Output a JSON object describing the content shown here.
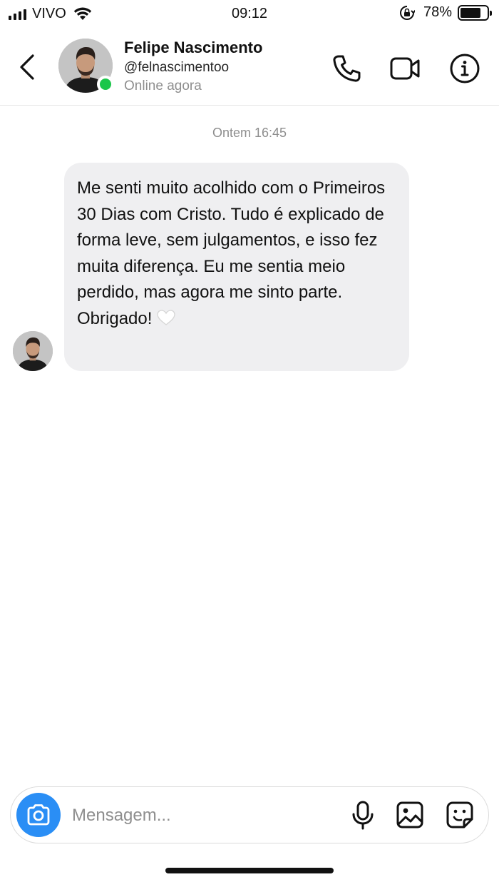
{
  "status_bar": {
    "carrier": "VIVO",
    "time": "09:12",
    "battery_percent": "78%",
    "battery_level": 0.78,
    "icons": [
      "signal-icon",
      "wifi-icon",
      "orientation-lock-icon",
      "battery-icon"
    ]
  },
  "header": {
    "name": "Felipe Nascimento",
    "username": "@felnascimentoo",
    "status": "Online agora",
    "online_color": "#1bc64a",
    "icons": [
      "back-icon",
      "phone-icon",
      "video-icon",
      "info-icon"
    ]
  },
  "chat": {
    "timestamp": "Ontem 16:45",
    "message": {
      "text": "Me senti muito acolhido com o Primeiros 30 Dias com Cristo. Tudo é explicado de forma leve, sem julgamentos, e isso fez muita diferença. Eu me sentia meio perdido, mas agora me sinto parte. Obrigado!",
      "emoji_icon": "white-heart-icon",
      "bubble_color": "#efeff1"
    }
  },
  "composer": {
    "placeholder": "Mensagem...",
    "camera_color": "#2a8ef5",
    "icons": [
      "camera-icon",
      "microphone-icon",
      "gallery-icon",
      "sticker-icon"
    ]
  }
}
